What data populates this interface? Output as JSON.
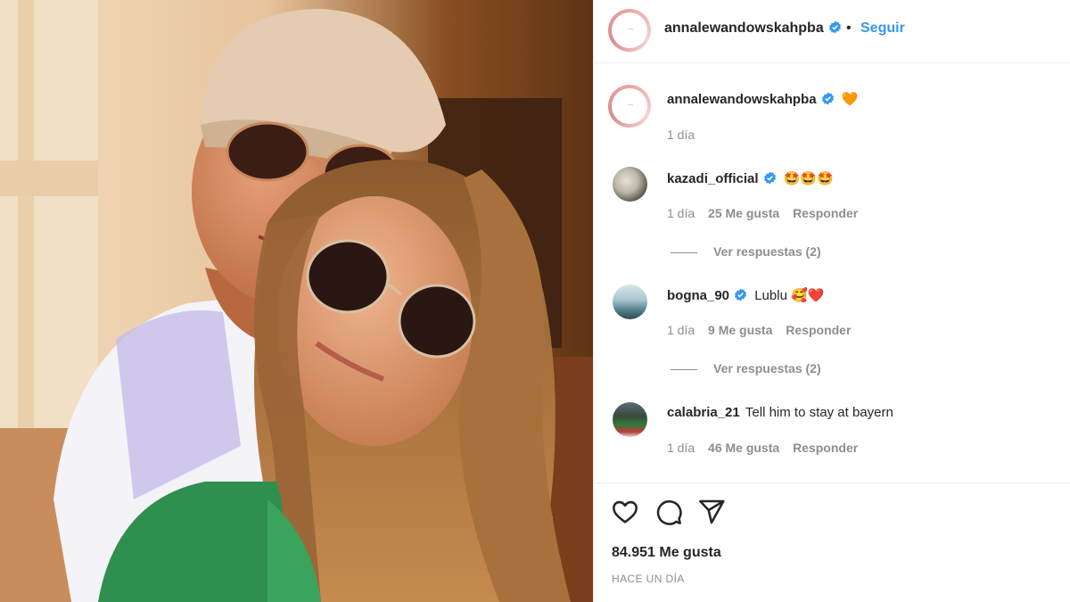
{
  "post": {
    "author": "annalewandowskahpba",
    "follow_label": "Seguir",
    "separator": "•",
    "caption": {
      "username": "annalewandowskahpba",
      "emoji": "🧡",
      "time": "1 día"
    }
  },
  "comments": [
    {
      "username": "kazadi_official",
      "text": "🤩🤩🤩",
      "time": "1 día",
      "likes": "25 Me gusta",
      "reply_label": "Responder",
      "view_replies": "Ver respuestas (2)"
    },
    {
      "username": "bogna_90",
      "text": "Lublu 🥰❤️",
      "time": "1 día",
      "likes": "9 Me gusta",
      "reply_label": "Responder",
      "view_replies": "Ver respuestas (2)"
    },
    {
      "username": "calabria_21",
      "text": "Tell him to stay at bayern",
      "time": "1 día",
      "likes": "46 Me gusta",
      "reply_label": "Responder"
    }
  ],
  "footer": {
    "likes": "84.951 Me gusta",
    "when": "HACE UN DÍA"
  },
  "icons": {
    "like": "heart-icon",
    "comment": "comment-icon",
    "share": "share-icon",
    "verified": "verified-badge-icon"
  },
  "colors": {
    "link_blue": "#3897f0",
    "verified_blue": "#3897f0",
    "muted_text": "#8e8e8e",
    "text": "#262626",
    "divider": "#efefef"
  }
}
